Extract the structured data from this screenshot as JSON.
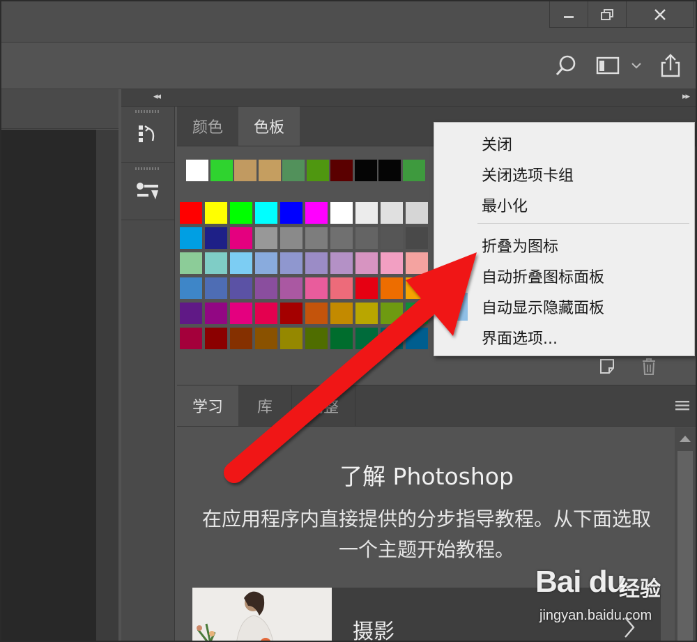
{
  "window": {
    "controls": [
      "minimize-icon",
      "restore-icon",
      "close-icon"
    ]
  },
  "optionsbar": {
    "icons": [
      "search-icon",
      "workspace-icon",
      "chevron-down-icon",
      "share-icon"
    ]
  },
  "panel_collapse": {
    "left": "◂◂",
    "right": "▸▸"
  },
  "swatch_panel": {
    "tabs": [
      {
        "label": "颜色",
        "active": false
      },
      {
        "label": "色板",
        "active": true
      }
    ],
    "recent_swatches": [
      "#ffffff",
      "#2fd32f",
      "#c19a61",
      "#c59e60",
      "#52915b",
      "#4f9710",
      "#5a0000",
      "#050505",
      "#050505",
      "#3e9a3e"
    ],
    "swatch_rows": [
      [
        "#ff0000",
        "#ffff00",
        "#00ff00",
        "#00ffff",
        "#0000ff",
        "#ff00ff",
        "#ffffff",
        "#ececec",
        "#e0e0e0",
        "#d6d6d6"
      ],
      [
        "#009fe3",
        "#1e2087",
        "#e4007f",
        "#989898",
        "#8a8a8a",
        "#7d7d7d",
        "#707070",
        "#646464",
        "#565656",
        "#494949"
      ],
      [
        "#8ccc98",
        "#7fcdc6",
        "#7ccdf3",
        "#89abdd",
        "#8f97cf",
        "#9b8cc6",
        "#b491c6",
        "#d794c1",
        "#f29fc2",
        "#f4a3a0"
      ],
      [
        "#3e86c8",
        "#4e6db4",
        "#5b52a5",
        "#8a4e9e",
        "#aa58a2",
        "#e95c9c",
        "#ed6b7a",
        "#e60012",
        "#ed6d00",
        "#f6a400"
      ],
      [
        "#601986",
        "#920783",
        "#e4007f",
        "#e4004f",
        "#a40000",
        "#c4540b",
        "#c38a00",
        "#b9a600",
        "#6e9a11",
        "#0f8b3a"
      ],
      [
        "#a4003b",
        "#8b0000",
        "#853000",
        "#8a5200",
        "#958800",
        "#4f6d00",
        "#006d2d",
        "#006b3b",
        "#005e63",
        "#005e8f"
      ]
    ],
    "menu_button_icon": "panel-menu-icon",
    "footer_icons": [
      "new-swatch-icon",
      "trash-icon"
    ]
  },
  "context_menu": {
    "items": [
      "关闭",
      "关闭选项卡组",
      "最小化",
      "折叠为图标",
      "自动折叠图标面板",
      "自动显示隐藏面板",
      "界面选项..."
    ],
    "checked_item_index": 5,
    "checked_swatch_color": "#8fbfe6"
  },
  "learn_panel": {
    "tabs": [
      {
        "label": "学习",
        "active": true
      },
      {
        "label": "库",
        "active": false
      },
      {
        "label": "调整",
        "active": false
      }
    ],
    "title": "了解 Photoshop",
    "description": "在应用程序内直接提供的分步指导教程。从下面选取一个主题开始教程。",
    "card_label": "摄影"
  },
  "annotation": {
    "arrow_color": "#f01414"
  },
  "watermark": {
    "logo": "Bai du",
    "cn": "经验",
    "url": "jingyan.baidu.com"
  },
  "colors": {
    "panel_bg": "#535353",
    "tab_bar": "#424242",
    "canvas": "#282828",
    "menu_bg": "#efefef"
  }
}
